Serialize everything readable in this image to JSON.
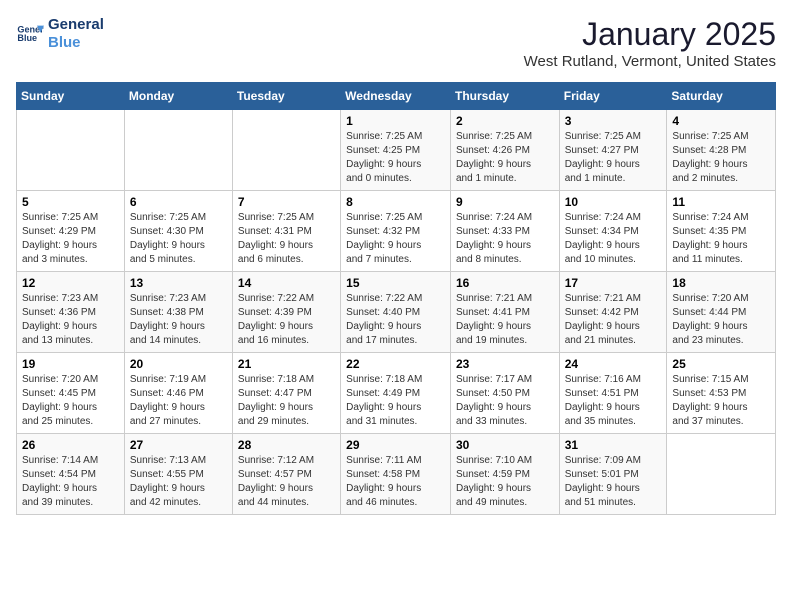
{
  "header": {
    "logo_line1": "General",
    "logo_line2": "Blue",
    "title": "January 2025",
    "subtitle": "West Rutland, Vermont, United States"
  },
  "days_of_week": [
    "Sunday",
    "Monday",
    "Tuesday",
    "Wednesday",
    "Thursday",
    "Friday",
    "Saturday"
  ],
  "weeks": [
    [
      {
        "day": "",
        "info": ""
      },
      {
        "day": "",
        "info": ""
      },
      {
        "day": "",
        "info": ""
      },
      {
        "day": "1",
        "info": "Sunrise: 7:25 AM\nSunset: 4:25 PM\nDaylight: 9 hours\nand 0 minutes."
      },
      {
        "day": "2",
        "info": "Sunrise: 7:25 AM\nSunset: 4:26 PM\nDaylight: 9 hours\nand 1 minute."
      },
      {
        "day": "3",
        "info": "Sunrise: 7:25 AM\nSunset: 4:27 PM\nDaylight: 9 hours\nand 1 minute."
      },
      {
        "day": "4",
        "info": "Sunrise: 7:25 AM\nSunset: 4:28 PM\nDaylight: 9 hours\nand 2 minutes."
      }
    ],
    [
      {
        "day": "5",
        "info": "Sunrise: 7:25 AM\nSunset: 4:29 PM\nDaylight: 9 hours\nand 3 minutes."
      },
      {
        "day": "6",
        "info": "Sunrise: 7:25 AM\nSunset: 4:30 PM\nDaylight: 9 hours\nand 5 minutes."
      },
      {
        "day": "7",
        "info": "Sunrise: 7:25 AM\nSunset: 4:31 PM\nDaylight: 9 hours\nand 6 minutes."
      },
      {
        "day": "8",
        "info": "Sunrise: 7:25 AM\nSunset: 4:32 PM\nDaylight: 9 hours\nand 7 minutes."
      },
      {
        "day": "9",
        "info": "Sunrise: 7:24 AM\nSunset: 4:33 PM\nDaylight: 9 hours\nand 8 minutes."
      },
      {
        "day": "10",
        "info": "Sunrise: 7:24 AM\nSunset: 4:34 PM\nDaylight: 9 hours\nand 10 minutes."
      },
      {
        "day": "11",
        "info": "Sunrise: 7:24 AM\nSunset: 4:35 PM\nDaylight: 9 hours\nand 11 minutes."
      }
    ],
    [
      {
        "day": "12",
        "info": "Sunrise: 7:23 AM\nSunset: 4:36 PM\nDaylight: 9 hours\nand 13 minutes."
      },
      {
        "day": "13",
        "info": "Sunrise: 7:23 AM\nSunset: 4:38 PM\nDaylight: 9 hours\nand 14 minutes."
      },
      {
        "day": "14",
        "info": "Sunrise: 7:22 AM\nSunset: 4:39 PM\nDaylight: 9 hours\nand 16 minutes."
      },
      {
        "day": "15",
        "info": "Sunrise: 7:22 AM\nSunset: 4:40 PM\nDaylight: 9 hours\nand 17 minutes."
      },
      {
        "day": "16",
        "info": "Sunrise: 7:21 AM\nSunset: 4:41 PM\nDaylight: 9 hours\nand 19 minutes."
      },
      {
        "day": "17",
        "info": "Sunrise: 7:21 AM\nSunset: 4:42 PM\nDaylight: 9 hours\nand 21 minutes."
      },
      {
        "day": "18",
        "info": "Sunrise: 7:20 AM\nSunset: 4:44 PM\nDaylight: 9 hours\nand 23 minutes."
      }
    ],
    [
      {
        "day": "19",
        "info": "Sunrise: 7:20 AM\nSunset: 4:45 PM\nDaylight: 9 hours\nand 25 minutes."
      },
      {
        "day": "20",
        "info": "Sunrise: 7:19 AM\nSunset: 4:46 PM\nDaylight: 9 hours\nand 27 minutes."
      },
      {
        "day": "21",
        "info": "Sunrise: 7:18 AM\nSunset: 4:47 PM\nDaylight: 9 hours\nand 29 minutes."
      },
      {
        "day": "22",
        "info": "Sunrise: 7:18 AM\nSunset: 4:49 PM\nDaylight: 9 hours\nand 31 minutes."
      },
      {
        "day": "23",
        "info": "Sunrise: 7:17 AM\nSunset: 4:50 PM\nDaylight: 9 hours\nand 33 minutes."
      },
      {
        "day": "24",
        "info": "Sunrise: 7:16 AM\nSunset: 4:51 PM\nDaylight: 9 hours\nand 35 minutes."
      },
      {
        "day": "25",
        "info": "Sunrise: 7:15 AM\nSunset: 4:53 PM\nDaylight: 9 hours\nand 37 minutes."
      }
    ],
    [
      {
        "day": "26",
        "info": "Sunrise: 7:14 AM\nSunset: 4:54 PM\nDaylight: 9 hours\nand 39 minutes."
      },
      {
        "day": "27",
        "info": "Sunrise: 7:13 AM\nSunset: 4:55 PM\nDaylight: 9 hours\nand 42 minutes."
      },
      {
        "day": "28",
        "info": "Sunrise: 7:12 AM\nSunset: 4:57 PM\nDaylight: 9 hours\nand 44 minutes."
      },
      {
        "day": "29",
        "info": "Sunrise: 7:11 AM\nSunset: 4:58 PM\nDaylight: 9 hours\nand 46 minutes."
      },
      {
        "day": "30",
        "info": "Sunrise: 7:10 AM\nSunset: 4:59 PM\nDaylight: 9 hours\nand 49 minutes."
      },
      {
        "day": "31",
        "info": "Sunrise: 7:09 AM\nSunset: 5:01 PM\nDaylight: 9 hours\nand 51 minutes."
      },
      {
        "day": "",
        "info": ""
      }
    ]
  ]
}
